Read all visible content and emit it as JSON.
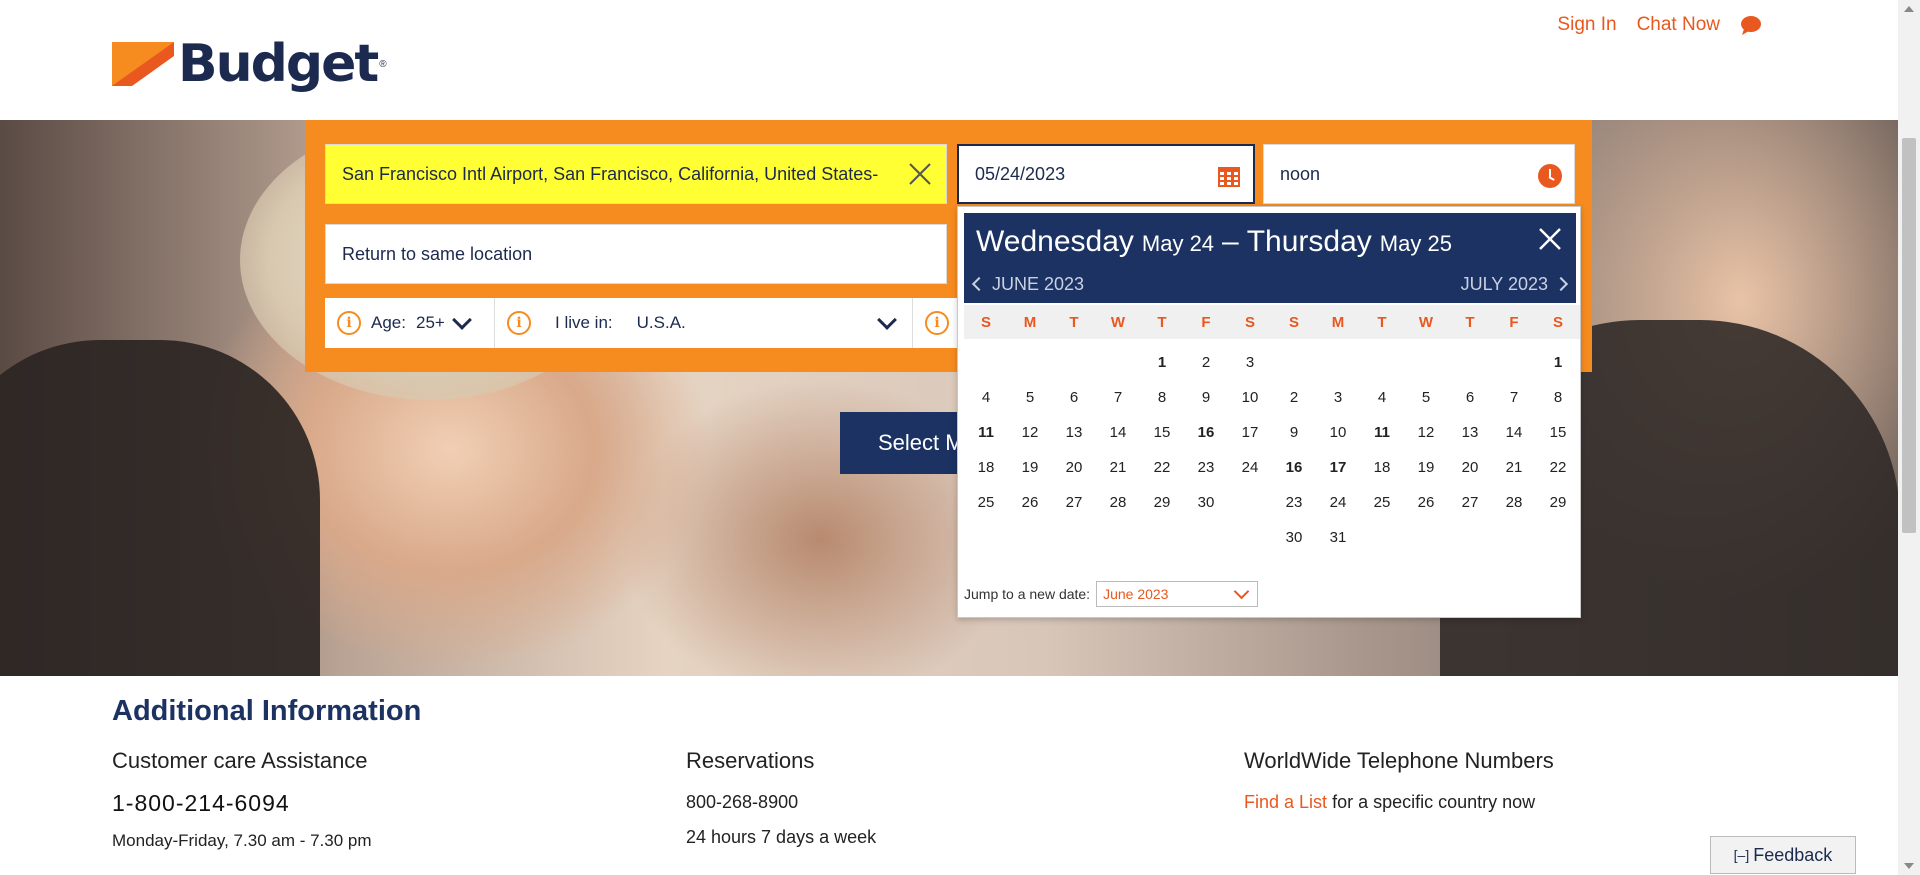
{
  "brand": {
    "name": "Budget",
    "reg": "®"
  },
  "top_links": {
    "sign_in": "Sign In",
    "chat_now": "Chat Now"
  },
  "search": {
    "pickup_location": "San Francisco Intl Airport, San Francisco, California, United States-",
    "pickup_date": "05/24/2023",
    "pickup_time": "noon",
    "return_location": "Return to same location",
    "age_label": "Age:",
    "age_value": "25+",
    "live_in_label": "I live in:",
    "live_in_value": "U.S.A.",
    "select_button": "Select M"
  },
  "calendar": {
    "header": {
      "start_day": "Wednesday",
      "start_date": "May 24",
      "separator": "–",
      "end_day": "Thursday",
      "end_date": "May 25"
    },
    "prev_month": "JUNE 2023",
    "next_month": "JULY 2023",
    "weekdays": [
      "S",
      "M",
      "T",
      "W",
      "T",
      "F",
      "S"
    ],
    "june": {
      "offset": 4,
      "days": [
        "1",
        "2",
        "3",
        "4",
        "5",
        "6",
        "7",
        "8",
        "9",
        "10",
        "11",
        "12",
        "13",
        "14",
        "15",
        "16",
        "17",
        "18",
        "19",
        "20",
        "21",
        "22",
        "23",
        "24",
        "25",
        "26",
        "27",
        "28",
        "29",
        "30"
      ],
      "bold": [
        "1",
        "11",
        "16"
      ]
    },
    "july": {
      "offset": 6,
      "days": [
        "1",
        "2",
        "3",
        "4",
        "5",
        "6",
        "7",
        "8",
        "9",
        "10",
        "11",
        "12",
        "13",
        "14",
        "15",
        "16",
        "17",
        "18",
        "19",
        "20",
        "21",
        "22",
        "23",
        "24",
        "25",
        "26",
        "27",
        "28",
        "29",
        "30",
        "31"
      ],
      "bold": [
        "1",
        "11",
        "16",
        "17"
      ]
    },
    "jump_label": "Jump to a new date:",
    "jump_value": "June 2023"
  },
  "additional": {
    "title": "Additional Information",
    "customer_care": {
      "heading": "Customer care Assistance",
      "phone": "1-800-214-6094",
      "hours": "Monday-Friday, 7.30 am - 7.30 pm"
    },
    "reservations": {
      "heading": "Reservations",
      "phone": "800-268-8900",
      "hours": "24 hours 7 days a week"
    },
    "worldwide": {
      "heading": "WorldWide Telephone Numbers",
      "link": "Find a List",
      "suffix": "for a specific country now"
    }
  },
  "feedback": {
    "prefix": "[–]",
    "label": "Feedback"
  },
  "colors": {
    "orange": "#f68b1f",
    "navy": "#1b3262",
    "accent": "#e8581f",
    "highlight": "#ffff33"
  }
}
